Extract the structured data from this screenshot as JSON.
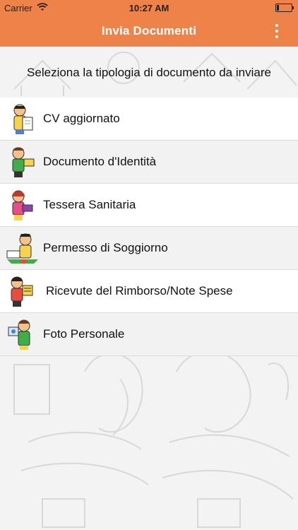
{
  "status_bar": {
    "carrier": "Carrier",
    "time": "10:27 AM"
  },
  "nav": {
    "title": "Invia Documenti",
    "menu_icon": "vertical-ellipsis-icon"
  },
  "header": {
    "title": "Seleziona la tipologia di documento da inviare"
  },
  "documents": [
    {
      "label": "CV aggiornato",
      "icon": "cv-person-icon"
    },
    {
      "label": "Documento d'Identità",
      "icon": "id-person-icon"
    },
    {
      "label": "Tessera Sanitaria",
      "icon": "health-card-person-icon"
    },
    {
      "label": "Permesso di Soggiorno",
      "icon": "residence-permit-person-icon"
    },
    {
      "label": "Ricevute del Rimborso/Note Spese",
      "icon": "receipts-person-icon"
    },
    {
      "label": "Foto Personale",
      "icon": "photo-person-icon"
    }
  ],
  "colors": {
    "accent": "#ee8349",
    "row_alt": "#f2f2f2",
    "row": "#ffffff"
  }
}
